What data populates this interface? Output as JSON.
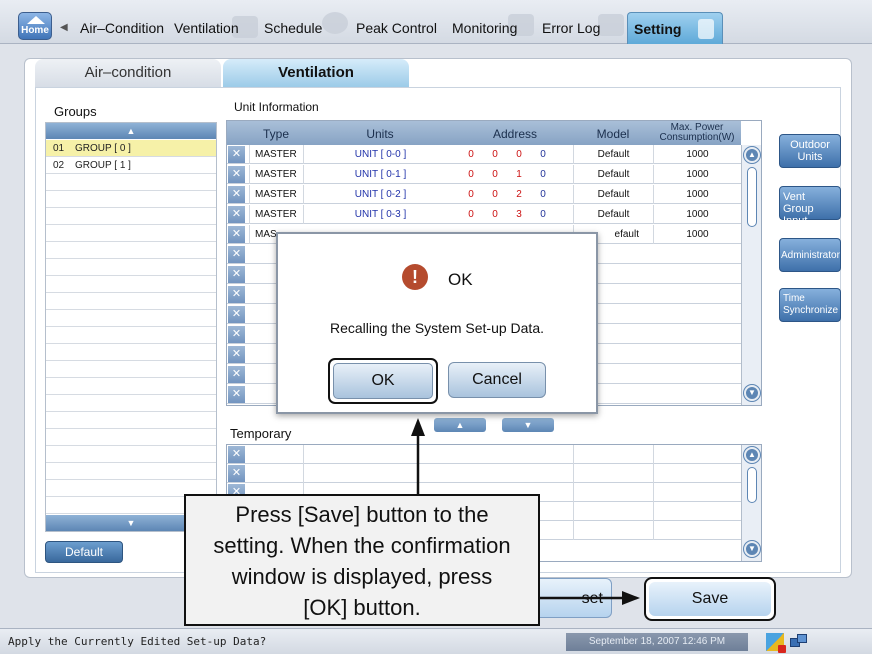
{
  "top_tabs": [
    {
      "label": "Air–Condition"
    },
    {
      "label": "Ventilation"
    },
    {
      "label": "Schedule"
    },
    {
      "label": "Peak Control"
    },
    {
      "label": "Monitoring"
    },
    {
      "label": "Error Log"
    },
    {
      "label": "Setting"
    }
  ],
  "home_label": "Home",
  "sub_tabs": {
    "air_condition": "Air–condition",
    "ventilation": "Ventilation"
  },
  "groups": {
    "title": "Groups",
    "items": [
      {
        "num": "01",
        "name": "GROUP [ 0 ]"
      },
      {
        "num": "02",
        "name": "GROUP [ 1 ]"
      }
    ],
    "default_button": "Default"
  },
  "unit_info": {
    "title": "Unit Information",
    "headers": {
      "type": "Type",
      "units": "Units",
      "address": "Address",
      "model": "Model",
      "power": "Max. Power Consumption(W)"
    },
    "rows": [
      {
        "type": "MASTER",
        "unit": "UNIT [ 0-0 ]",
        "a1": "0",
        "a2": "0",
        "a3": "0",
        "a4": "0",
        "model": "Default",
        "power": "1000"
      },
      {
        "type": "MASTER",
        "unit": "UNIT [ 0-1 ]",
        "a1": "0",
        "a2": "0",
        "a3": "1",
        "a4": "0",
        "model": "Default",
        "power": "1000"
      },
      {
        "type": "MASTER",
        "unit": "UNIT [ 0-2 ]",
        "a1": "0",
        "a2": "0",
        "a3": "2",
        "a4": "0",
        "model": "Default",
        "power": "1000"
      },
      {
        "type": "MASTER",
        "unit": "UNIT [ 0-3 ]",
        "a1": "0",
        "a2": "0",
        "a3": "3",
        "a4": "0",
        "model": "Default",
        "power": "1000"
      },
      {
        "type": "MAS",
        "unit": "",
        "a1": "",
        "a2": "",
        "a3": "",
        "a4": "",
        "model": "efault",
        "power": "1000"
      }
    ]
  },
  "side_buttons": {
    "outdoor_units": "Outdoor Units",
    "vent_group_input": "Vent Group Input",
    "administrator": "Administrator",
    "time_sync": "Time Synchronize"
  },
  "temporary": {
    "title": "Temporary"
  },
  "bottom": {
    "reset_label": "set",
    "save_label": "Save"
  },
  "status": {
    "message": "Apply the Currently Edited Set-up Data?",
    "datetime": "September 18, 2007 12:46 PM"
  },
  "dialog": {
    "title": "OK",
    "message": "Recalling the System Set-up Data.",
    "ok_label": "OK",
    "cancel_label": "Cancel"
  },
  "callout": {
    "line1": "Press [Save] button to the",
    "line2": "setting. When the confirmation",
    "line3": "window is displayed, press",
    "line4": "[OK] button."
  },
  "icons": [
    "home-icon",
    "left-arrow-icon",
    "warning-icon",
    "scroll-up-icon",
    "scroll-down-icon",
    "remove-icon",
    "network-icon",
    "alert-icon"
  ],
  "colors": {
    "accent": "#5ea9d8",
    "selected_row": "#f6f1a8",
    "warning": "#b54b2e",
    "address_red": "#cc1111"
  }
}
